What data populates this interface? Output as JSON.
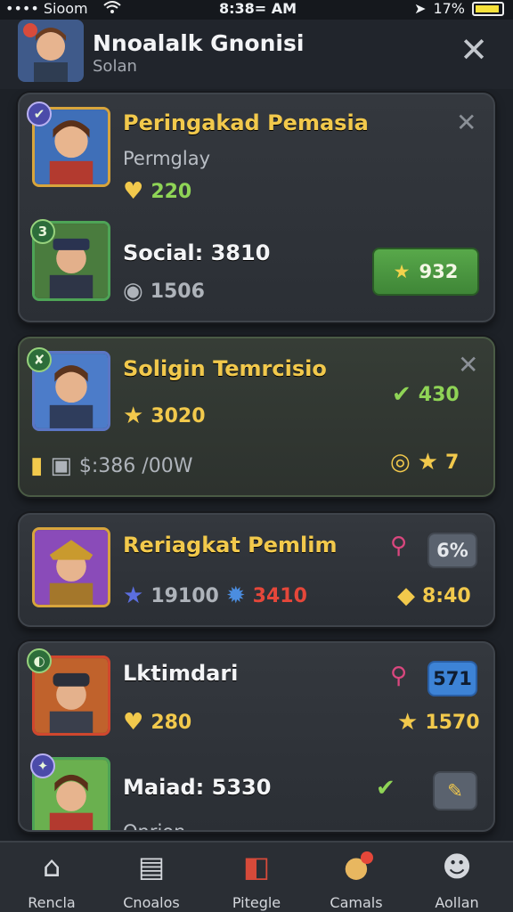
{
  "status": {
    "carrier": "•••• Sioom",
    "time": "8:38= AM",
    "battery": "17%"
  },
  "header": {
    "title": "Nnoalalk Gnonisi",
    "subtitle": "Solan",
    "close": "✕"
  },
  "cards": [
    {
      "title": "Peringakad Pemasia",
      "subtitle": "Permglay",
      "stat1": "220",
      "row2_title": "Social: 3810",
      "row2_value": "1506",
      "button": "932"
    },
    {
      "title": "Soligin Temrcisio",
      "stat1": "3020",
      "right_stat": "430",
      "price": "$:386 /00W",
      "right_value": "7"
    },
    {
      "title": "Reriagkat Pemlim",
      "stat1": "19100",
      "stat2": "3410",
      "badge": "6%",
      "right_value": "8:40"
    },
    {
      "title": "Lktimdari",
      "stat1": "280",
      "badge": "571",
      "right_value": "1570",
      "row2_title": "Maiad: 5330",
      "row2_sub": "Onrion"
    }
  ],
  "colors": {
    "background": "#1d2127",
    "card": "#31353b",
    "gold": "#f2c94c",
    "green": "#8fd456",
    "blue": "#3d83d6"
  },
  "nav": [
    {
      "label": "Rencla",
      "icon": "home-icon"
    },
    {
      "label": "Cnoalos",
      "icon": "cards-icon"
    },
    {
      "label": "Pitegle",
      "icon": "deck-icon"
    },
    {
      "label": "Camals",
      "icon": "chat-icon"
    },
    {
      "label": "Aollan",
      "icon": "profile-icon"
    }
  ]
}
